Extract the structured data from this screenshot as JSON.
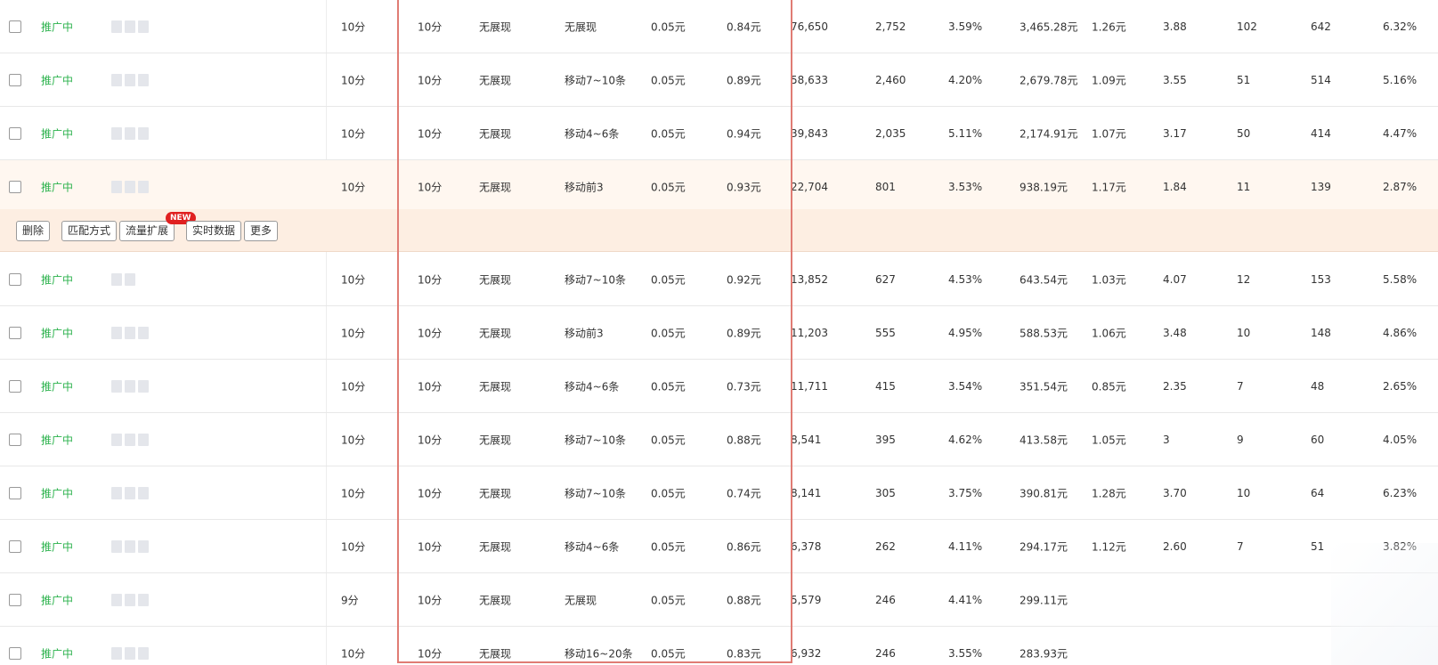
{
  "rows": [
    {
      "status": "推广中",
      "quality": "10分",
      "quality2": "10分",
      "pc_rank": "无展现",
      "mobile_rank": "无展现",
      "bid_low": "0.05元",
      "bid": "0.84元",
      "impressions": "76,650",
      "clicks": "2,752",
      "ctr": "3.59%",
      "cost": "3,465.28元",
      "cpc": "1.26元",
      "c1": "3.88",
      "c2": "102",
      "c3": "642",
      "c4": "6.32%"
    },
    {
      "status": "推广中",
      "quality": "10分",
      "quality2": "10分",
      "pc_rank": "无展现",
      "mobile_rank": "移动7~10条",
      "bid_low": "0.05元",
      "bid": "0.89元",
      "impressions": "58,633",
      "clicks": "2,460",
      "ctr": "4.20%",
      "cost": "2,679.78元",
      "cpc": "1.09元",
      "c1": "3.55",
      "c2": "51",
      "c3": "514",
      "c4": "5.16%"
    },
    {
      "status": "推广中",
      "quality": "10分",
      "quality2": "10分",
      "pc_rank": "无展现",
      "mobile_rank": "移动4~6条",
      "bid_low": "0.05元",
      "bid": "0.94元",
      "impressions": "39,843",
      "clicks": "2,035",
      "ctr": "5.11%",
      "cost": "2,174.91元",
      "cpc": "1.07元",
      "c1": "3.17",
      "c2": "50",
      "c3": "414",
      "c4": "4.47%"
    },
    {
      "status": "推广中",
      "quality": "10分",
      "quality2": "10分",
      "pc_rank": "无展现",
      "mobile_rank": "移动前3",
      "bid_low": "0.05元",
      "bid": "0.93元",
      "impressions": "22,704",
      "clicks": "801",
      "ctr": "3.53%",
      "cost": "938.19元",
      "cpc": "1.17元",
      "c1": "1.84",
      "c2": "11",
      "c3": "139",
      "c4": "2.87%"
    },
    {
      "status": "推广中",
      "quality": "10分",
      "quality2": "10分",
      "pc_rank": "无展现",
      "mobile_rank": "移动7~10条",
      "bid_low": "0.05元",
      "bid": "0.92元",
      "impressions": "13,852",
      "clicks": "627",
      "ctr": "4.53%",
      "cost": "643.54元",
      "cpc": "1.03元",
      "c1": "4.07",
      "c2": "12",
      "c3": "153",
      "c4": "5.58%"
    },
    {
      "status": "推广中",
      "quality": "10分",
      "quality2": "10分",
      "pc_rank": "无展现",
      "mobile_rank": "移动前3",
      "bid_low": "0.05元",
      "bid": "0.89元",
      "impressions": "11,203",
      "clicks": "555",
      "ctr": "4.95%",
      "cost": "588.53元",
      "cpc": "1.06元",
      "c1": "3.48",
      "c2": "10",
      "c3": "148",
      "c4": "4.86%"
    },
    {
      "status": "推广中",
      "quality": "10分",
      "quality2": "10分",
      "pc_rank": "无展现",
      "mobile_rank": "移动4~6条",
      "bid_low": "0.05元",
      "bid": "0.73元",
      "impressions": "11,711",
      "clicks": "415",
      "ctr": "3.54%",
      "cost": "351.54元",
      "cpc": "0.85元",
      "c1": "2.35",
      "c2": "7",
      "c3": "48",
      "c4": "2.65%"
    },
    {
      "status": "推广中",
      "quality": "10分",
      "quality2": "10分",
      "pc_rank": "无展现",
      "mobile_rank": "移动7~10条",
      "bid_low": "0.05元",
      "bid": "0.88元",
      "impressions": "8,541",
      "clicks": "395",
      "ctr": "4.62%",
      "cost": "413.58元",
      "cpc": "1.05元",
      "c1": "3",
      "c2": "9",
      "c3": "60",
      "c4": "4.05%"
    },
    {
      "status": "推广中",
      "quality": "10分",
      "quality2": "10分",
      "pc_rank": "无展现",
      "mobile_rank": "移动7~10条",
      "bid_low": "0.05元",
      "bid": "0.74元",
      "impressions": "8,141",
      "clicks": "305",
      "ctr": "3.75%",
      "cost": "390.81元",
      "cpc": "1.28元",
      "c1": "3.70",
      "c2": "10",
      "c3": "64",
      "c4": "6.23%"
    },
    {
      "status": "推广中",
      "quality": "10分",
      "quality2": "10分",
      "pc_rank": "无展现",
      "mobile_rank": "移动4~6条",
      "bid_low": "0.05元",
      "bid": "0.86元",
      "impressions": "6,378",
      "clicks": "262",
      "ctr": "4.11%",
      "cost": "294.17元",
      "cpc": "1.12元",
      "c1": "2.60",
      "c2": "7",
      "c3": "51",
      "c4": "3.82%"
    },
    {
      "status": "推广中",
      "quality": "9分",
      "quality2": "10分",
      "pc_rank": "无展现",
      "mobile_rank": "无展现",
      "bid_low": "0.05元",
      "bid": "0.88元",
      "impressions": "5,579",
      "clicks": "246",
      "ctr": "4.41%",
      "cost": "299.11元",
      "cpc": "",
      "c1": "",
      "c2": "",
      "c3": "",
      "c4": ""
    },
    {
      "status": "推广中",
      "quality": "10分",
      "quality2": "10分",
      "pc_rank": "无展现",
      "mobile_rank": "移动16~20条",
      "bid_low": "0.05元",
      "bid": "0.83元",
      "impressions": "6,932",
      "clicks": "246",
      "ctr": "3.55%",
      "cost": "283.93元",
      "cpc": "",
      "c1": "",
      "c2": "",
      "c3": "",
      "c4": ""
    }
  ],
  "action_bar": {
    "delete_label": "删除",
    "match_label": "匹配方式",
    "traffic_label": "流量扩展",
    "new_badge": "NEW",
    "realtime_label": "实时数据",
    "more_label": "更多"
  },
  "colors": {
    "status_green": "#2bb24c",
    "highlight_row": "#fff7f0",
    "action_bar_bg": "#fdeee2",
    "focus_box": "#e07c74",
    "new_badge": "#e02020"
  }
}
